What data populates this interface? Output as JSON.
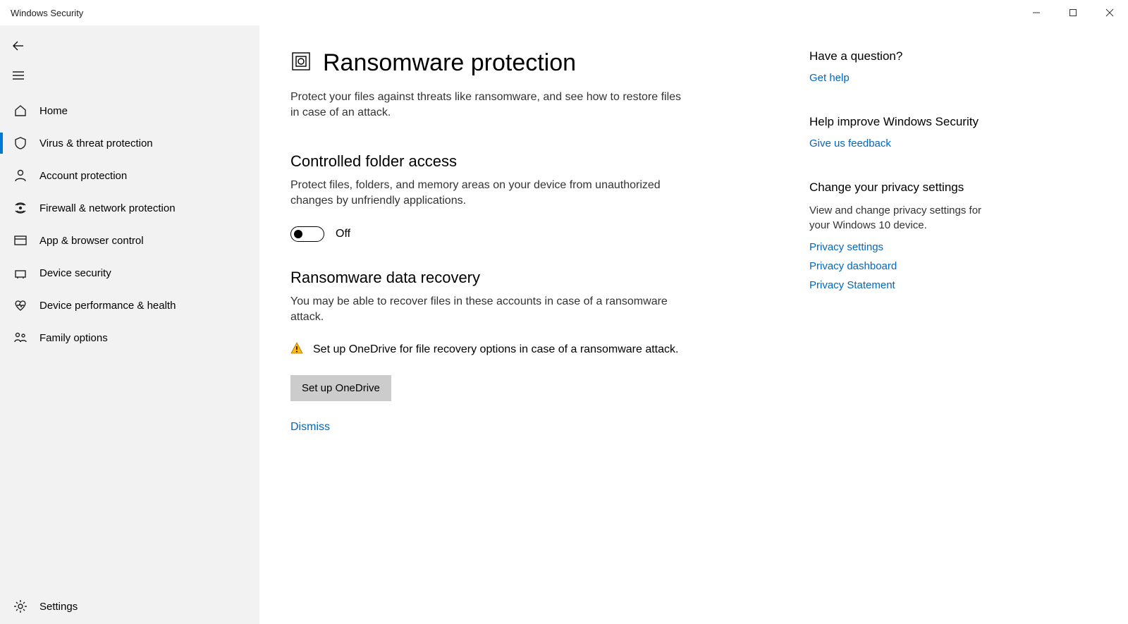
{
  "window": {
    "title": "Windows Security"
  },
  "sidebar": {
    "items": [
      {
        "label": "Home"
      },
      {
        "label": "Virus & threat protection"
      },
      {
        "label": "Account protection"
      },
      {
        "label": "Firewall & network protection"
      },
      {
        "label": "App & browser control"
      },
      {
        "label": "Device security"
      },
      {
        "label": "Device performance & health"
      },
      {
        "label": "Family options"
      }
    ],
    "settings": "Settings"
  },
  "page": {
    "title": "Ransomware protection",
    "lead": "Protect your files against threats like ransomware, and see how to restore files in case of an attack."
  },
  "cfa": {
    "title": "Controlled folder access",
    "desc": "Protect files, folders, and memory areas on your device from unauthorized changes by unfriendly applications.",
    "toggle_state": "Off"
  },
  "recovery": {
    "title": "Ransomware data recovery",
    "desc": "You may be able to recover files in these accounts in case of a ransomware attack.",
    "alert": "Set up OneDrive for file recovery options in case of a ransomware attack.",
    "button": "Set up OneDrive",
    "dismiss": "Dismiss"
  },
  "rail": {
    "question": {
      "title": "Have a question?",
      "link": "Get help"
    },
    "improve": {
      "title": "Help improve Windows Security",
      "link": "Give us feedback"
    },
    "privacy": {
      "title": "Change your privacy settings",
      "text": "View and change privacy settings for your Windows 10 device.",
      "links": [
        "Privacy settings",
        "Privacy dashboard",
        "Privacy Statement"
      ]
    }
  }
}
